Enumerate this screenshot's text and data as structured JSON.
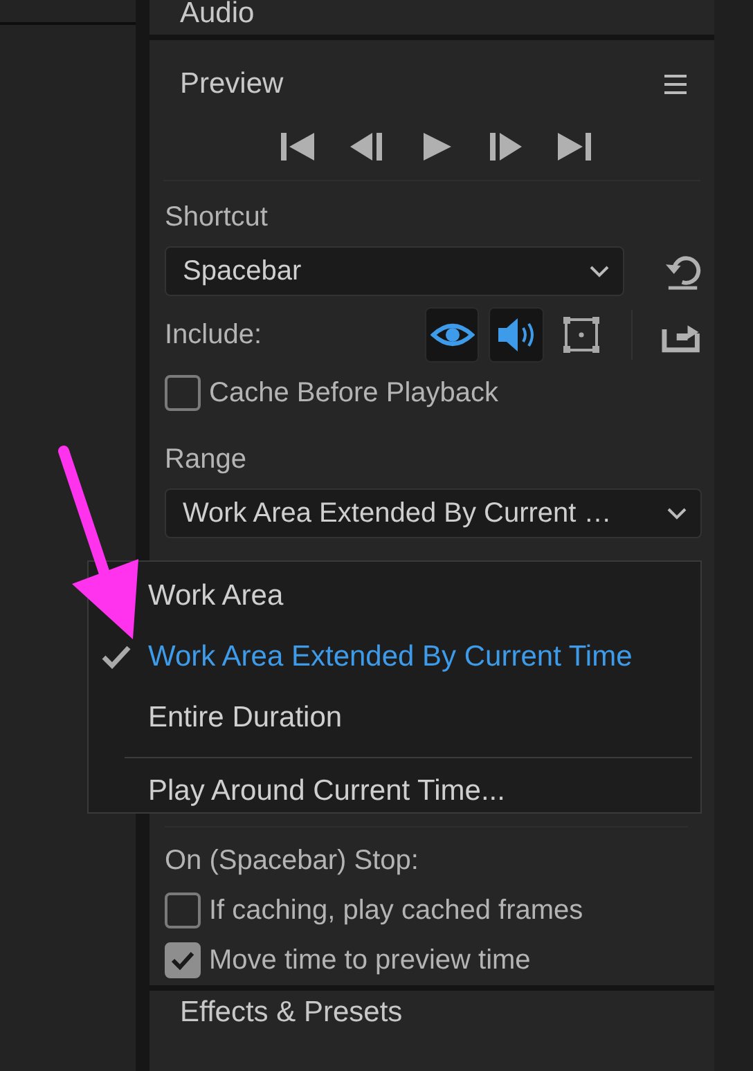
{
  "audio_panel": {
    "title": "Audio"
  },
  "preview": {
    "title": "Preview",
    "shortcut": {
      "label": "Shortcut",
      "value": "Spacebar"
    },
    "include": {
      "label": "Include:",
      "toggles": [
        {
          "kind": "video",
          "on": true
        },
        {
          "kind": "audio",
          "on": true
        },
        {
          "kind": "overlays",
          "on": false
        }
      ]
    },
    "cache_before_playback": {
      "label": "Cache Before Playback",
      "checked": false
    },
    "range": {
      "label": "Range",
      "value": "Work Area Extended By Current …"
    },
    "on_stop": {
      "label": "On (Spacebar) Stop:",
      "options": [
        {
          "label": "If caching, play cached frames",
          "checked": false
        },
        {
          "label": "Move time to preview time",
          "checked": true
        }
      ]
    }
  },
  "range_menu": {
    "items": [
      {
        "kind": "option",
        "label": "Work Area",
        "selected": false
      },
      {
        "kind": "option",
        "label": "Work Area Extended By Current Time",
        "selected": true
      },
      {
        "kind": "option",
        "label": "Entire Duration",
        "selected": false
      },
      {
        "kind": "separator"
      },
      {
        "kind": "option",
        "label": "Play Around Current Time...",
        "selected": false
      }
    ]
  },
  "next_panel": {
    "title": "Effects & Presets"
  }
}
